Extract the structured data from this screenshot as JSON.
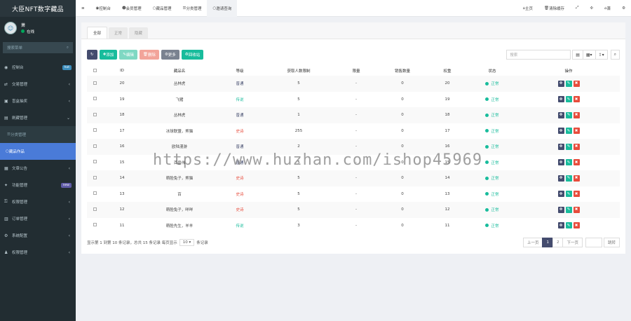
{
  "sidebar": {
    "logo": "大臣NFT数字藏品",
    "user": {
      "name": "萧",
      "status": "在线"
    },
    "search_placeholder": "搜索菜单",
    "items": [
      {
        "label": "控制台",
        "icon": "dashboard-icon",
        "badge": "hot",
        "badge_color": "#3c8dbc"
      },
      {
        "label": "交易管理",
        "icon": "trade-icon",
        "arrow": "‹"
      },
      {
        "label": "盲盒抽奖",
        "icon": "gift-icon",
        "arrow": "‹"
      },
      {
        "label": "刷藏管理",
        "icon": "collection-icon",
        "arrow": "⌄"
      }
    ],
    "sub_items": [
      {
        "label": "分类管理"
      },
      {
        "label": "藏品作品"
      }
    ],
    "items_after": [
      {
        "label": "文章公告",
        "icon": "article-icon",
        "arrow": "‹"
      },
      {
        "label": "功能管理",
        "icon": "function-icon",
        "badge": "new",
        "badge_color": "#605ca8"
      },
      {
        "label": "权限管理",
        "icon": "auth-icon",
        "arrow": "‹"
      },
      {
        "label": "订单管理",
        "icon": "order-icon",
        "arrow": "‹"
      },
      {
        "label": "系统配置",
        "icon": "config-icon",
        "arrow": "‹"
      },
      {
        "label": "权限管理",
        "icon": "perm-icon",
        "arrow": "‹"
      }
    ]
  },
  "topbar": {
    "tabs": [
      {
        "label": "控制台",
        "icon": "dashboard-icon"
      },
      {
        "label": "会员管理",
        "icon": "user-icon"
      },
      {
        "label": "藏品管理",
        "icon": "circle-icon"
      },
      {
        "label": "分类管理",
        "icon": "list-icon"
      },
      {
        "label": "邀请查询",
        "icon": "circle-icon",
        "active": true
      }
    ],
    "right": [
      {
        "label": "主页",
        "icon": "home-icon"
      },
      {
        "label": "清除缓存",
        "icon": "trash-icon"
      }
    ],
    "user_label": "萧"
  },
  "content": {
    "tabs": [
      {
        "label": "全部",
        "active": true
      },
      {
        "label": "正常"
      },
      {
        "label": "隐藏"
      }
    ],
    "toolbar": {
      "refresh": "",
      "add": "添加",
      "edit": "编辑",
      "delete": "删除",
      "more": "更多",
      "recycle": "回收站",
      "search_placeholder": "搜索"
    },
    "columns": [
      "",
      "ID",
      "藏品名",
      "等级",
      "获取人数限制",
      "限量",
      "销售数量",
      "权重",
      "状态",
      "操作"
    ],
    "rows": [
      {
        "id": "20",
        "name": "丛林虎",
        "level": "普通",
        "level_color": "#444c6e",
        "limit": "5",
        "qty": "-",
        "sold": "0",
        "weight": "20",
        "status": "正常"
      },
      {
        "id": "19",
        "name": "飞猪",
        "level": "传说",
        "level_color": "#18bc9c",
        "limit": "5",
        "qty": "-",
        "sold": "0",
        "weight": "19",
        "status": "正常"
      },
      {
        "id": "18",
        "name": "丛林虎",
        "level": "普通",
        "level_color": "#444c6e",
        "limit": "1",
        "qty": "-",
        "sold": "0",
        "weight": "18",
        "status": "正常"
      },
      {
        "id": "17",
        "name": "冰球联盟，熊猫",
        "level": "史诗",
        "level_color": "#e74c3c",
        "limit": "255",
        "qty": "-",
        "sold": "0",
        "weight": "17",
        "status": "正常"
      },
      {
        "id": "16",
        "name": "欧陆漫游",
        "level": "普通",
        "level_color": "#444c6e",
        "limit": "2",
        "qty": "-",
        "sold": "0",
        "weight": "16",
        "status": "正常"
      },
      {
        "id": "15",
        "name": "百兽伟",
        "level": "普通",
        "level_color": "#444c6e",
        "limit": "5",
        "qty": "-",
        "sold": "0",
        "weight": "15",
        "status": "正常"
      },
      {
        "id": "14",
        "name": "萌脸兔子，熊猫",
        "level": "史诗",
        "level_color": "#e74c3c",
        "limit": "5",
        "qty": "-",
        "sold": "0",
        "weight": "14",
        "status": "正常"
      },
      {
        "id": "13",
        "name": "百",
        "level": "史诗",
        "level_color": "#e74c3c",
        "limit": "5",
        "qty": "-",
        "sold": "0",
        "weight": "13",
        "status": "正常"
      },
      {
        "id": "12",
        "name": "萌脸兔子，咩咩",
        "level": "史诗",
        "level_color": "#e74c3c",
        "limit": "5",
        "qty": "-",
        "sold": "0",
        "weight": "12",
        "status": "正常"
      },
      {
        "id": "11",
        "name": "萌脸先生，羊羊",
        "level": "传说",
        "level_color": "#18bc9c",
        "limit": "3",
        "qty": "-",
        "sold": "0",
        "weight": "11",
        "status": "正常"
      }
    ],
    "footer": {
      "text_before": "显示第 1 到第 10 条记录，总共 15 条记录 每页显示",
      "page_size": "10",
      "text_after": "条记录"
    },
    "pager": {
      "prev": "上一页",
      "pages": [
        "1",
        "2"
      ],
      "current": "1",
      "next": "下一页",
      "jump": "跳转"
    }
  },
  "watermark": "https://www.huzhan.com/ishop45969"
}
